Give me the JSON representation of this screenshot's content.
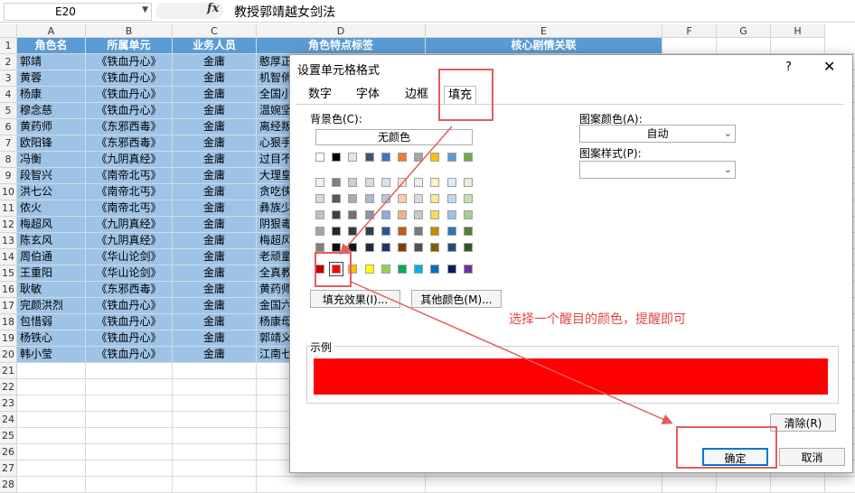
{
  "formula_bar": {
    "name_box": "E20",
    "dropdown": "▼",
    "fx": "fx",
    "formula": "教授郭靖越女剑法"
  },
  "columns": [
    "A",
    "B",
    "C",
    "D",
    "E",
    "F",
    "G",
    "H"
  ],
  "rows": [
    "1",
    "2",
    "3",
    "4",
    "5",
    "6",
    "7",
    "8",
    "9",
    "10",
    "11",
    "12",
    "13",
    "14",
    "15",
    "16",
    "17",
    "18",
    "19",
    "20",
    "21",
    "22",
    "23",
    "24",
    "25",
    "26",
    "27",
    "28"
  ],
  "header_row": [
    "角色名",
    "所属单元",
    "业务人员",
    "角色特点标签",
    "核心剧情关联"
  ],
  "table_rows": [
    [
      "郭靖",
      "《铁血丹心》",
      "金庸",
      "憨厚正"
    ],
    [
      "黄蓉",
      "《铁血丹心》",
      "金庸",
      "机智俏"
    ],
    [
      "杨康",
      "《铁血丹心》",
      "金庸",
      "全国小"
    ],
    [
      "穆念慈",
      "《铁血丹心》",
      "金庸",
      "温婉坚"
    ],
    [
      "黄药师",
      "《东邪西毒》",
      "金庸",
      "离经叛"
    ],
    [
      "欧阳锋",
      "《东邪西毒》",
      "金庸",
      "心狠手"
    ],
    [
      "冯衡",
      "《九阴真经》",
      "金庸",
      "过目不"
    ],
    [
      "段智兴",
      "《南帝北丐》",
      "金庸",
      "大理皇"
    ],
    [
      "洪七公",
      "《南帝北丐》",
      "金庸",
      "贪吃侠"
    ],
    [
      "侬火",
      "《南帝北丐》",
      "金庸",
      "彝族少"
    ],
    [
      "梅超风",
      "《九阴真经》",
      "金庸",
      "阴狠毒"
    ],
    [
      "陈玄风",
      "《九阴真经》",
      "金庸",
      "梅超风"
    ],
    [
      "周伯通",
      "《华山论剑》",
      "金庸",
      "老顽童"
    ],
    [
      "王重阳",
      "《华山论剑》",
      "金庸",
      "全真教"
    ],
    [
      "耿敏",
      "《东邪西毒》",
      "金庸",
      "黄药师"
    ],
    [
      "完颜洪烈",
      "《铁血丹心》",
      "金庸",
      "金国六"
    ],
    [
      "包惜弱",
      "《铁血丹心》",
      "金庸",
      "杨康母"
    ],
    [
      "杨铁心",
      "《铁血丹心》",
      "金庸",
      "郭靖义"
    ],
    [
      "韩小莹",
      "《铁血丹心》",
      "金庸",
      "江南七"
    ]
  ],
  "dialog": {
    "title": "设置单元格格式",
    "help": "?",
    "close": "✕",
    "tabs": [
      "数字",
      "字体",
      "边框",
      "填充"
    ],
    "background_label": "背景色(C):",
    "no_color": "无颜色",
    "pattern_color_label": "图案颜色(A):",
    "pattern_color_value": "自动",
    "pattern_style_label": "图案样式(P):",
    "fill_effects": "填充效果(I)...",
    "more_colors": "其他颜色(M)...",
    "sample_label": "示例",
    "clear": "清除(R)",
    "ok": "确定",
    "cancel": "取消",
    "sample_color": "#ff0000"
  },
  "annotation": "选择一个醒目的颜色，提醒即可",
  "palette": {
    "theme_top": [
      "#ffffff",
      "#000000",
      "#e7e6e6",
      "#44546a",
      "#4472c4",
      "#ed7d31",
      "#a5a5a5",
      "#ffc000",
      "#5b9bd5",
      "#70ad47"
    ],
    "theme_shades": [
      [
        "#f2f2f2",
        "#808080",
        "#d0cece",
        "#d6dce4",
        "#d9e2f3",
        "#fbe5d5",
        "#ededed",
        "#fff2cc",
        "#deeaf6",
        "#e2efd9"
      ],
      [
        "#d8d8d8",
        "#595959",
        "#aeabab",
        "#adb9ca",
        "#b4c6e7",
        "#f7cbac",
        "#dbdbdb",
        "#fee599",
        "#bdd7ee",
        "#c5e0b3"
      ],
      [
        "#bfbfbf",
        "#3f3f3f",
        "#757070",
        "#8496b0",
        "#8eaadb",
        "#f4b183",
        "#c9c9c9",
        "#ffd965",
        "#9cc3e5",
        "#a8d08d"
      ],
      [
        "#a5a5a5",
        "#262626",
        "#3a3838",
        "#323f4f",
        "#2f5496",
        "#c55a11",
        "#7b7b7b",
        "#bf8f00",
        "#2e75b5",
        "#538135"
      ],
      [
        "#7f7f7f",
        "#0c0c0c",
        "#171616",
        "#222a35",
        "#1f3864",
        "#833c0b",
        "#525252",
        "#7f6000",
        "#1e4e79",
        "#375623"
      ]
    ],
    "standard": [
      "#c00000",
      "#ff0000",
      "#ffc000",
      "#ffff00",
      "#92d050",
      "#00b050",
      "#00b0f0",
      "#0070c0",
      "#002060",
      "#7030a0"
    ]
  }
}
